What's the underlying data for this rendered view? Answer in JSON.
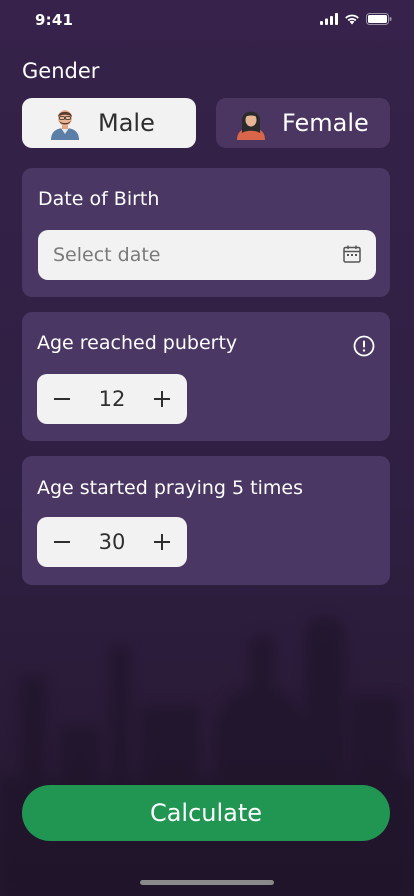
{
  "status_bar": {
    "time": "9:41",
    "icons": [
      "signal-icon",
      "wifi-icon",
      "battery-icon"
    ]
  },
  "gender": {
    "label": "Gender",
    "selected": "Male",
    "options": [
      {
        "label": "Male",
        "icon": "male-avatar-icon"
      },
      {
        "label": "Female",
        "icon": "female-avatar-icon"
      }
    ]
  },
  "date_of_birth": {
    "title": "Date of Birth",
    "placeholder": "Select date",
    "icon": "calendar-icon"
  },
  "puberty": {
    "title": "Age reached puberty",
    "value": "12",
    "icon": "info-icon",
    "decrement_icon": "minus-icon",
    "increment_icon": "plus-icon"
  },
  "prayer": {
    "title": "Age started praying 5 times",
    "value": "30",
    "decrement_icon": "minus-icon",
    "increment_icon": "plus-icon"
  },
  "actions": {
    "calculate_label": "Calculate"
  },
  "colors": {
    "background": "#32203f",
    "card": "#4b3763",
    "primary": "#219652",
    "selected_option": "#f2f2f2"
  }
}
